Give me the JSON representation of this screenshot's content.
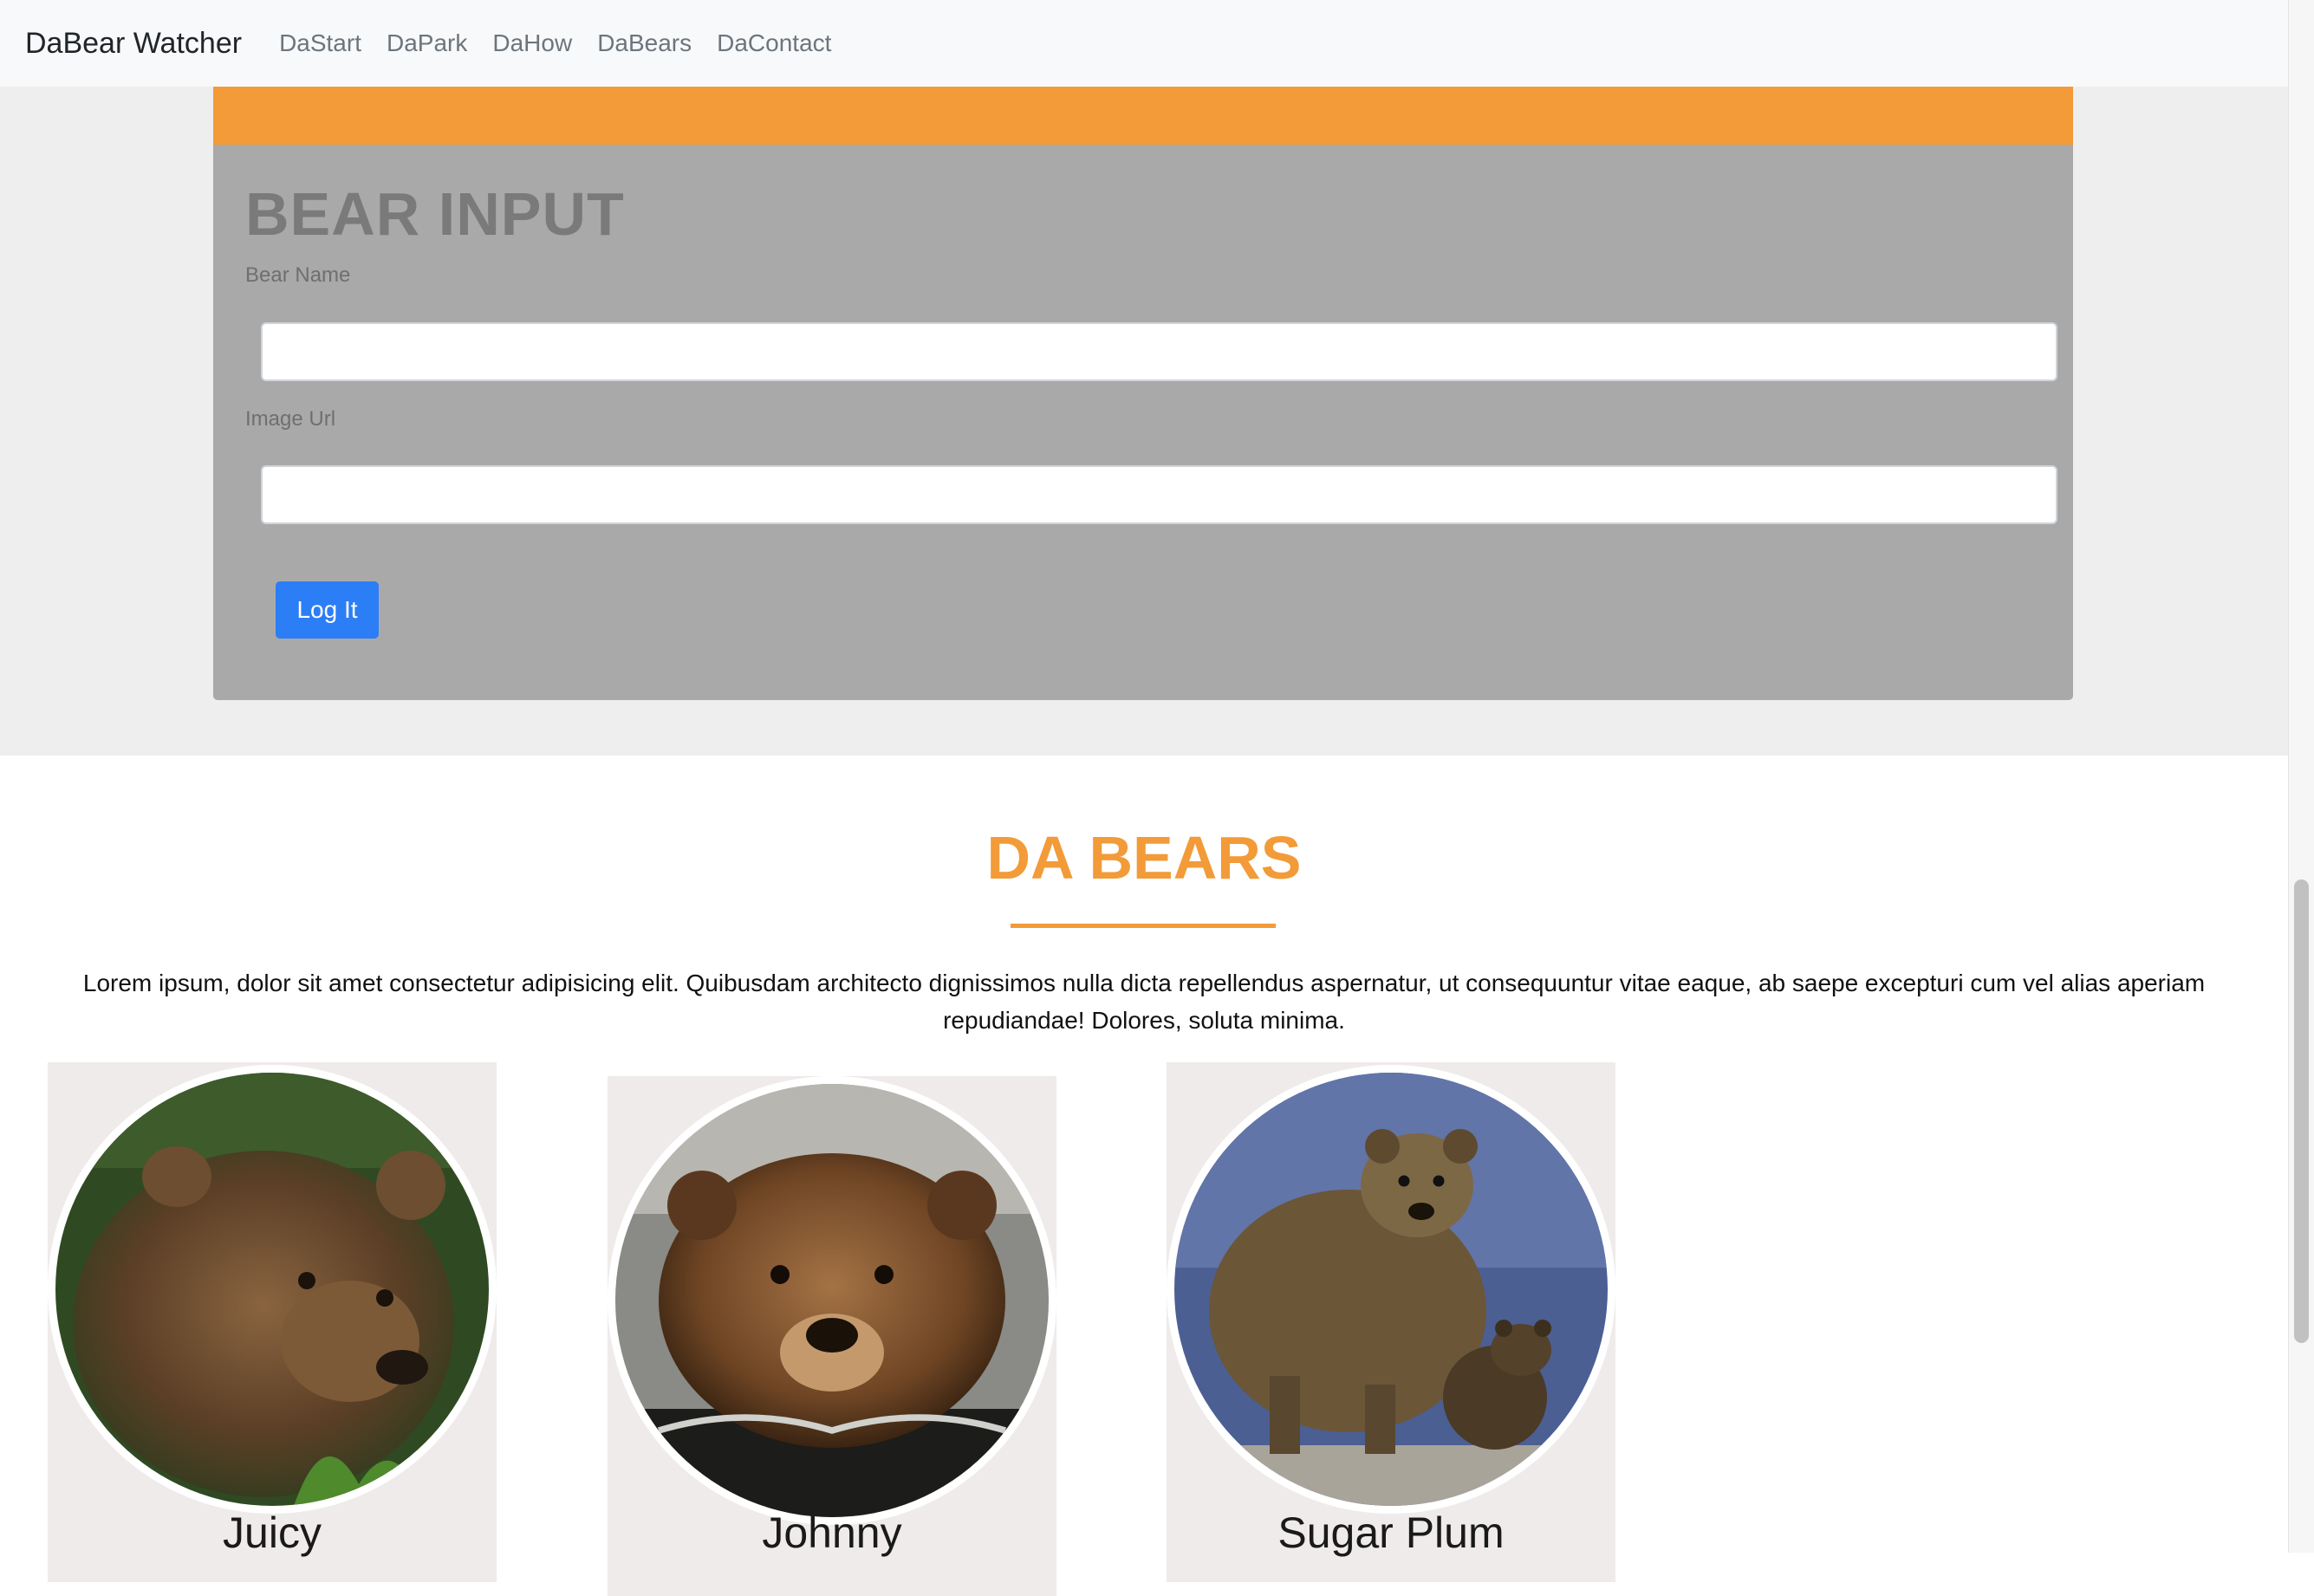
{
  "navbar": {
    "brand": "DaBear Watcher",
    "links": [
      "DaStart",
      "DaPark",
      "DaHow",
      "DaBears",
      "DaContact"
    ]
  },
  "form": {
    "title": "BEAR INPUT",
    "name_label": "Bear Name",
    "name_value": "",
    "url_label": "Image Url",
    "url_value": "",
    "submit_label": "Log It"
  },
  "bears_section": {
    "title": "DA BEARS",
    "description": "Lorem ipsum, dolor sit amet consectetur adipisicing elit. Quibusdam architecto dignissimos nulla dicta repellendus aspernatur, ut consequuntur vitae eaque, ab saepe excepturi cum vel alias aperiam repudiandae! Dolores, soluta minima.",
    "bears": [
      {
        "name": "Juicy",
        "scene": "bear-in-grass"
      },
      {
        "name": "Johnny",
        "scene": "bear-swimming"
      },
      {
        "name": "Sugar Plum",
        "scene": "bear-with-cub"
      }
    ]
  },
  "colors": {
    "accent": "#f29b38",
    "button": "#2b7ef5",
    "form_panel": "#a9a9a9"
  }
}
